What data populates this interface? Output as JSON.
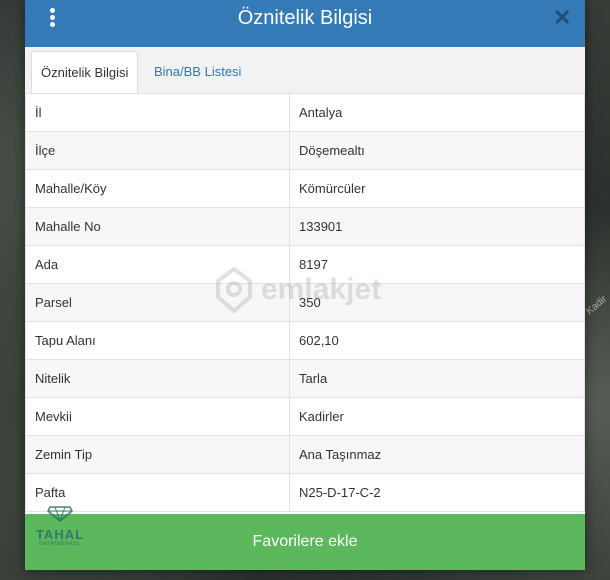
{
  "dialog": {
    "title": "Öznitelik Bilgisi"
  },
  "tabs": [
    {
      "label": "Öznitelik Bilgisi",
      "active": true
    },
    {
      "label": "Bina/BB Listesi",
      "active": false
    }
  ],
  "attributes": [
    {
      "key": "İl",
      "value": "Antalya"
    },
    {
      "key": "İlçe",
      "value": "Döşemealtı"
    },
    {
      "key": "Mahalle/Köy",
      "value": "Kömürcüler"
    },
    {
      "key": "Mahalle No",
      "value": "133901"
    },
    {
      "key": "Ada",
      "value": "8197"
    },
    {
      "key": "Parsel",
      "value": "350"
    },
    {
      "key": "Tapu Alanı",
      "value": "602,10"
    },
    {
      "key": "Nitelik",
      "value": "Tarla"
    },
    {
      "key": "Mevkii",
      "value": "Kadirler"
    },
    {
      "key": "Zemin Tip",
      "value": "Ana Taşınmaz"
    },
    {
      "key": "Pafta",
      "value": "N25-D-17-C-2"
    }
  ],
  "watermark": {
    "text": "emlakjet"
  },
  "footer": {
    "favorite_label": "Favorilere ekle"
  },
  "brand": {
    "name": "TAHAL",
    "sub": "GAYRIMENKUL"
  },
  "map": {
    "road_label": "Kadir"
  },
  "colors": {
    "header": "#337ab7",
    "favorite_button": "#5cb85c",
    "tab_link": "#337ab7"
  },
  "icons": {
    "menu": "vertical-dots-icon",
    "close": "close-icon"
  }
}
